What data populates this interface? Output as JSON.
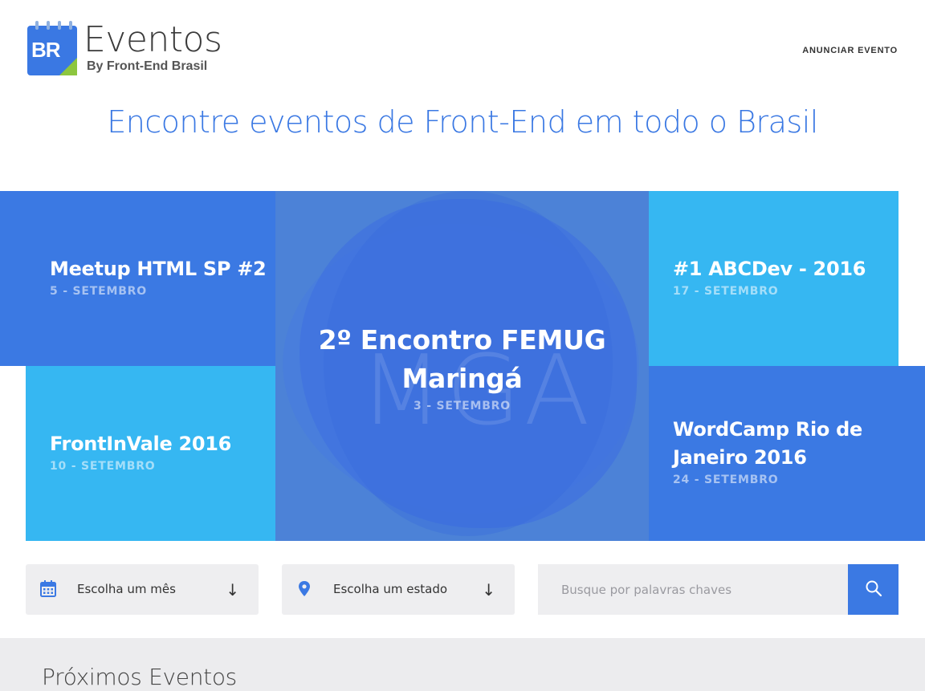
{
  "header": {
    "logo_badge": "BR",
    "logo_title": "Eventos",
    "logo_subtitle": "By Front-End Brasil",
    "nav_link": "ANUNCIAR EVENTO"
  },
  "hero": {
    "title": "Encontre eventos de Front-End em todo o Brasil"
  },
  "events": [
    {
      "title": "Meetup HTML SP #2",
      "date": "5 - SETEMBRO",
      "color": "#3b79e3"
    },
    {
      "title": "FrontInVale 2016",
      "date": "10 - SETEMBRO",
      "color": "#36b7f2"
    },
    {
      "title": "2º Encontro FEMUG Maringá",
      "date": "3 - SETEMBRO",
      "color": "#4c82d7",
      "watermark": "MGA"
    },
    {
      "title": "#1 ABCDev - 2016",
      "date": "17 - SETEMBRO",
      "color": "#36b7f2"
    },
    {
      "title": "WordCamp Rio de Janeiro 2016",
      "date": "24 - SETEMBRO",
      "color": "#3b79e3"
    }
  ],
  "filters": {
    "month": {
      "label": "Escolha um mês",
      "icon": "calendar-icon",
      "arrow": "↓"
    },
    "state": {
      "label": "Escolha um estado",
      "icon": "map-pin-icon",
      "arrow": "↓"
    },
    "search": {
      "placeholder": "Busque por palavras chaves",
      "value": "",
      "icon": "search-icon"
    }
  },
  "upcoming": {
    "title": "Próximos Eventos"
  },
  "colors": {
    "accent": "#3a78e3",
    "light_blue": "#36b7f2",
    "logo_green": "#8dc63f",
    "filter_bg": "#eeeef0"
  }
}
